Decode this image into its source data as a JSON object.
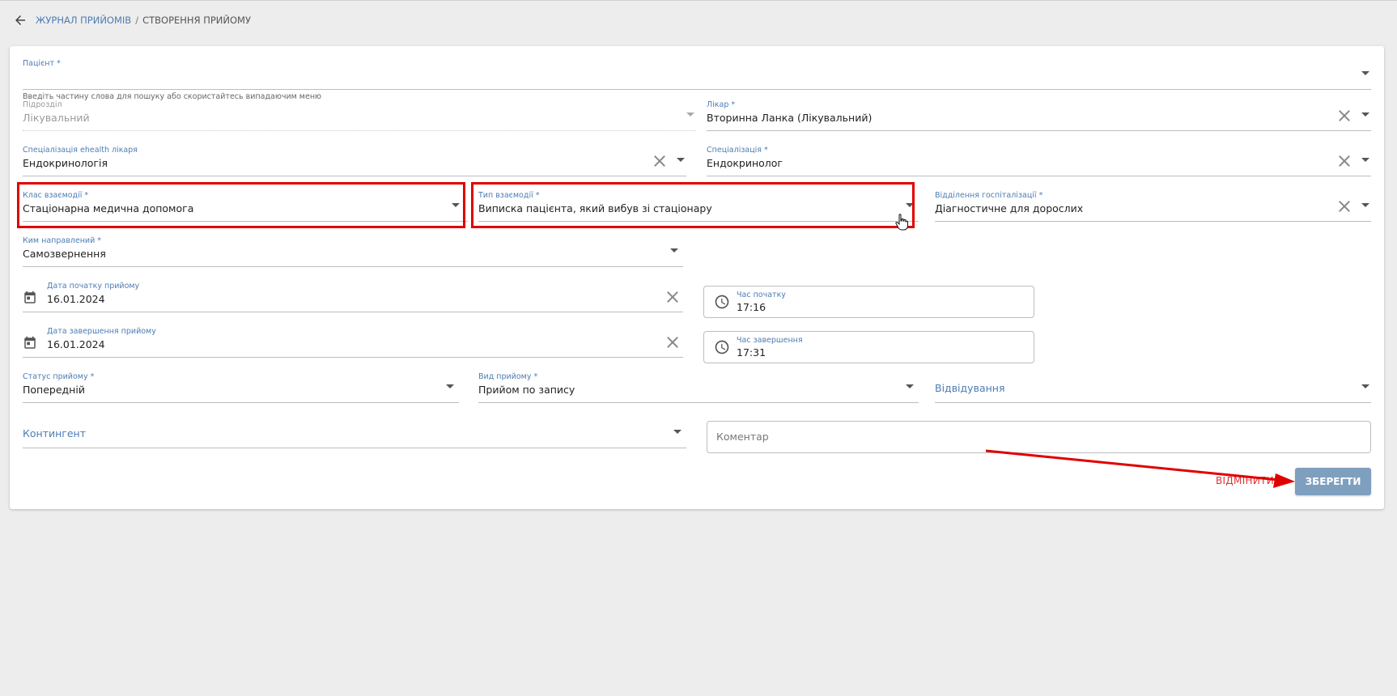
{
  "header": {
    "back_icon": "arrow-left-icon",
    "breadcrumb_link": "Журнал прийомів",
    "breadcrumb_separator": "/",
    "breadcrumb_current": "Створення прийому"
  },
  "form": {
    "patient": {
      "label": "Пацієнт *",
      "value": "",
      "helper": "Введіть частину слова для пошуку або скористайтесь випадаючим меню"
    },
    "division": {
      "label": "Підрозділ",
      "value": "Лікувальний"
    },
    "doctor": {
      "label": "Лікар *",
      "value": "Вторинна Ланка  (Лікувальний)"
    },
    "ehealth_specialization": {
      "label": "Спеціалізація ehealth лікаря",
      "value": "Ендокринологія"
    },
    "specialization": {
      "label": "Спеціалізація *",
      "value": "Ендокринолог"
    },
    "interaction_class": {
      "label": "Клас взаємодії *",
      "value": "Стаціонарна медична допомога"
    },
    "interaction_type": {
      "label": "Тип взаємодії *",
      "value": "Виписка пацієнта, який вибув зі стаціонару"
    },
    "hospital_department": {
      "label": "Відділення госпіталізації *",
      "value": "Діагностичне для дорослих"
    },
    "referred_by": {
      "label": "Ким направлений *",
      "value": "Самозвернення"
    },
    "start_date": {
      "label": "Дата початку прийому",
      "value": "16.01.2024"
    },
    "start_time": {
      "label": "Час початку",
      "value": "17:16"
    },
    "end_date": {
      "label": "Дата завершення прийому",
      "value": "16.01.2024"
    },
    "end_time": {
      "label": "Час завершення",
      "value": "17:31"
    },
    "status": {
      "label": "Статус прийому *",
      "value": "Попередній"
    },
    "visit_kind": {
      "label": "Вид прийому *",
      "value": "Прийом по запису"
    },
    "attendance": {
      "label": "Відвідування"
    },
    "contingent": {
      "label": "Контингент"
    },
    "comment": {
      "placeholder": "Коментар"
    }
  },
  "actions": {
    "cancel_label": "Відмінити",
    "save_label": "Зберегти"
  },
  "colors": {
    "accent": "#4d7cb3",
    "highlight": "#e10000",
    "save_button": "#7f9fbf",
    "background": "#ededed"
  }
}
